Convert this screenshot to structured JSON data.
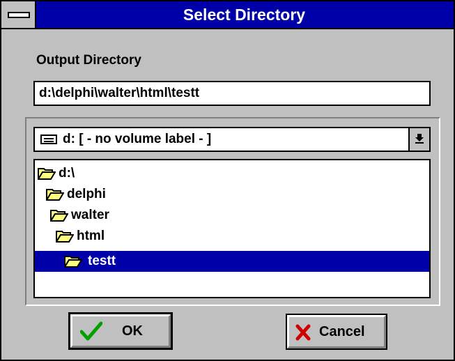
{
  "window": {
    "title": "Select Directory",
    "colors": {
      "titlebar": "#0000a8",
      "face": "#c0c0c0",
      "selection": "#0000a8",
      "folder": "#ffff80"
    }
  },
  "output": {
    "label": "Output Directory",
    "value": "d:\\delphi\\walter\\html\\testt"
  },
  "drive": {
    "icon": "drive-icon",
    "selected": "d: [ - no volume label - ]",
    "dropdown_icon": "chevron-down-icon"
  },
  "tree": {
    "items": [
      {
        "label": "d:\\",
        "icon": "folder-open-icon"
      },
      {
        "label": "delphi",
        "icon": "folder-open-icon"
      },
      {
        "label": "walter",
        "icon": "folder-open-icon"
      },
      {
        "label": "html",
        "icon": "folder-open-icon"
      },
      {
        "label": "testt",
        "icon": "folder-open-icon",
        "selected": true
      }
    ]
  },
  "buttons": {
    "ok_label": "OK",
    "ok_icon": "checkmark-icon",
    "cancel_label": "Cancel",
    "cancel_icon": "x-icon"
  }
}
